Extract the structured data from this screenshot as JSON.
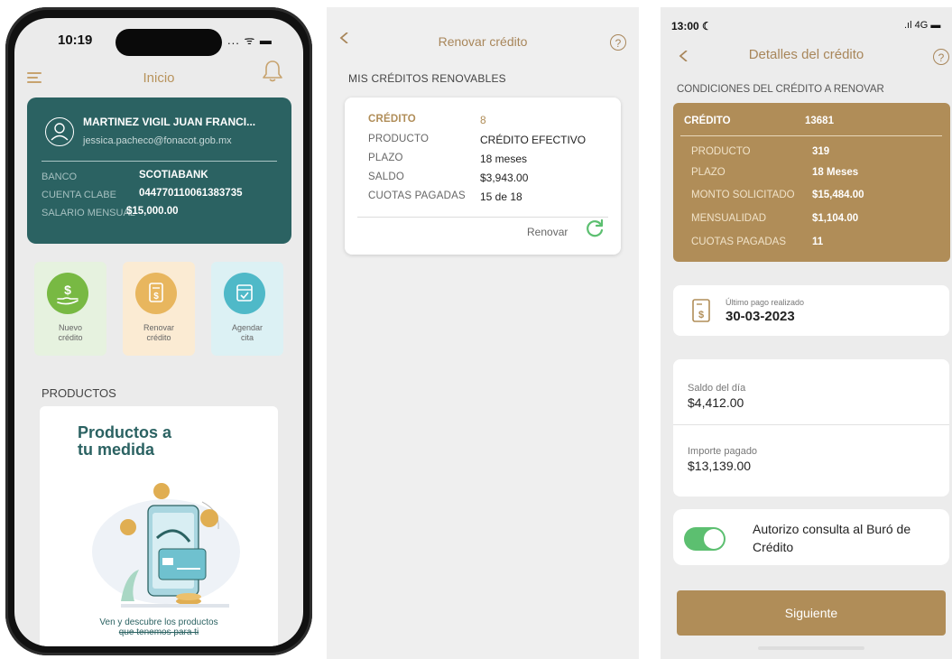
{
  "panel1": {
    "status": {
      "time": "10:19",
      "icons": "... ᯤ ▬"
    },
    "header": {
      "title": "Inicio"
    },
    "account": {
      "name": "MARTINEZ VIGIL JUAN FRANCI...",
      "email": "jessica.pacheco@fonacot.gob.mx",
      "rows": [
        {
          "label": "BANCO",
          "value": "SCOTIABANK"
        },
        {
          "label": "CUENTA CLABE",
          "value": "044770110061383735"
        },
        {
          "label": "SALARIO MENSUAL",
          "value": "$15,000.00"
        }
      ]
    },
    "tiles": [
      {
        "line1": "Nuevo",
        "line2": "crédito",
        "bg": "#e6f2df",
        "circle": "#78b943",
        "icon": "hand-dollar-icon"
      },
      {
        "line1": "Renovar",
        "line2": "crédito",
        "bg": "#fbebd3",
        "circle": "#e8b65e",
        "icon": "document-dollar-icon"
      },
      {
        "line1": "Agendar",
        "line2": "cita",
        "bg": "#dcf1f4",
        "circle": "#4fb9c8",
        "icon": "calendar-check-icon"
      }
    ],
    "products": {
      "section_label": "PRODUCTOS",
      "title_line1": "Productos a",
      "title_line2": "tu medida",
      "caption_line1": "Ven y descubre los productos",
      "caption_line2": "que tenemos para ti"
    }
  },
  "panel2": {
    "title": "Renovar crédito",
    "section": "MIS CRÉDITOS RENOVABLES",
    "credit": {
      "rows": [
        {
          "label": "CRÉDITO",
          "value": "8"
        },
        {
          "label": "PRODUCTO",
          "value": "CRÉDITO EFECTIVO"
        },
        {
          "label": "PLAZO",
          "value": "18 meses"
        },
        {
          "label": "SALDO",
          "value": "$3,943.00"
        },
        {
          "label": "CUOTAS PAGADAS",
          "value": "15 de 18"
        }
      ],
      "action": "Renovar"
    }
  },
  "panel3": {
    "status": {
      "time": "13:00 ☾",
      "icons": ".ıl 4G ▬"
    },
    "title": "Detalles del crédito",
    "section": "CONDICIONES DEL CRÉDITO A RENOVAR",
    "conditions": {
      "header": {
        "label": "CRÉDITO",
        "value": "13681"
      },
      "rows": [
        {
          "label": "PRODUCTO",
          "value": "319"
        },
        {
          "label": "PLAZO",
          "value": "18 Meses"
        },
        {
          "label": "MONTO SOLICITADO",
          "value": "$15,484.00"
        },
        {
          "label": "MENSUALIDAD",
          "value": "$1,104.00"
        },
        {
          "label": "CUOTAS PAGADAS",
          "value": "11"
        }
      ]
    },
    "last_payment": {
      "label": "Último pago realizado",
      "value": "30-03-2023"
    },
    "balance": {
      "saldo_label": "Saldo del día",
      "saldo_value": "$4,412.00",
      "importe_label": "Importe pagado",
      "importe_value": "$13,139.00"
    },
    "authorization": {
      "text": "Autorizo consulta al Buró de Crédito",
      "enabled": true
    },
    "next_button": "Siguiente"
  },
  "colors": {
    "teal": "#2b6262",
    "gold": "#b08d58",
    "gold_text": "#a8865a",
    "toggle_green": "#5cbf70"
  }
}
